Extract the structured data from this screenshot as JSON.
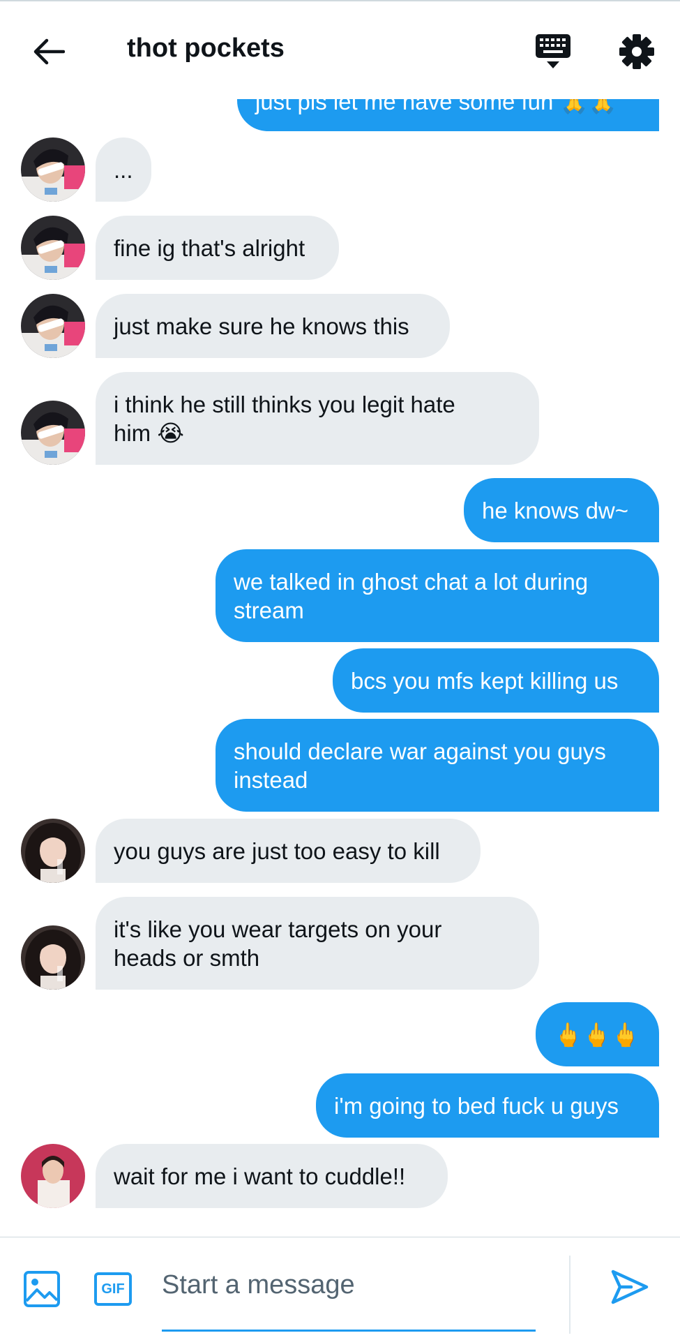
{
  "header": {
    "title": "thot pockets",
    "icons": [
      "back-arrow-icon",
      "keyboard-icon",
      "gear-icon"
    ]
  },
  "messages": [
    {
      "dir": "out",
      "text": "just pls let me have some fun 🙏🙏",
      "partial": true
    },
    {
      "dir": "in",
      "text": "...",
      "avatar": "avatar-1"
    },
    {
      "dir": "in",
      "text": "fine ig that's alright",
      "avatar": "avatar-1"
    },
    {
      "dir": "in",
      "text": "just make sure he knows this",
      "avatar": "avatar-1"
    },
    {
      "dir": "in",
      "text": "i think he still thinks you legit hate\nhim 😭",
      "avatar": "avatar-1"
    },
    {
      "dir": "out",
      "text": "he knows dw~"
    },
    {
      "dir": "out",
      "text": "we talked in ghost chat a lot during\nstream"
    },
    {
      "dir": "out",
      "text": "bcs you mfs kept killing us"
    },
    {
      "dir": "out",
      "text": "should declare war against you guys\ninstead"
    },
    {
      "dir": "in",
      "text": "you guys are just too easy to kill",
      "avatar": "avatar-2"
    },
    {
      "dir": "in",
      "text": "it's like you wear targets on your\nheads or smth",
      "avatar": "avatar-2"
    },
    {
      "dir": "out",
      "text": "🖕🖕🖕"
    },
    {
      "dir": "out",
      "text": "i'm going to bed fuck u guys"
    },
    {
      "dir": "in",
      "text": "wait for me i want to cuddle!!",
      "avatar": "avatar-3"
    }
  ],
  "composer": {
    "placeholder": "Start a message",
    "gif_label": "GIF",
    "icons": [
      "image-icon",
      "gif-icon",
      "send-icon"
    ]
  },
  "colors": {
    "accent": "#1d9bf0",
    "incoming_bubble": "#e8ecef",
    "outgoing_text": "#ffffff",
    "text": "#0f1419"
  }
}
